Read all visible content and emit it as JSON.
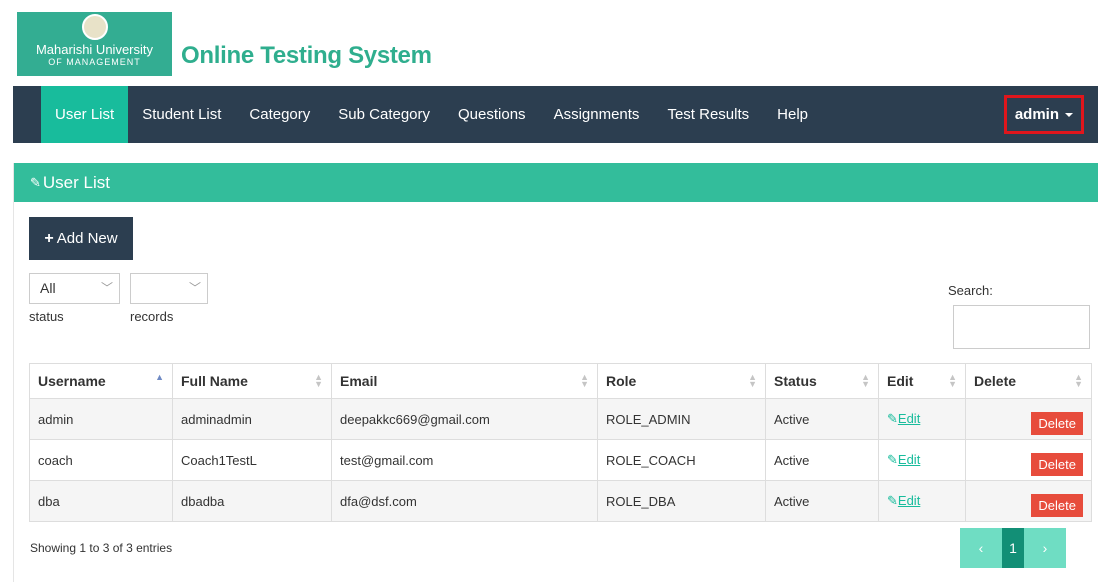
{
  "logo": {
    "line1": "Maharishi University",
    "line2": "OF MANAGEMENT"
  },
  "app_title": "Online Testing System",
  "nav": {
    "items": [
      "User List",
      "Student List",
      "Category",
      "Sub Category",
      "Questions",
      "Assignments",
      "Test Results",
      "Help"
    ],
    "active": "User List",
    "user_menu": "admin"
  },
  "panel": {
    "title": "User List",
    "add_button": "Add New",
    "status_filter": {
      "value": "All",
      "caption": "status"
    },
    "records_filter": {
      "value": "",
      "caption": "records"
    },
    "search_label": "Search:",
    "search_value": ""
  },
  "table": {
    "columns": [
      "Username",
      "Full Name",
      "Email",
      "Role",
      "Status",
      "Edit",
      "Delete"
    ],
    "rows": [
      {
        "username": "admin",
        "fullname": "adminadmin",
        "email": "deepakkc669@gmail.com",
        "role": "ROLE_ADMIN",
        "status": "Active",
        "edit": "Edit",
        "delete": "Delete"
      },
      {
        "username": "coach",
        "fullname": "Coach1TestL",
        "email": "test@gmail.com",
        "role": "ROLE_COACH",
        "status": "Active",
        "edit": "Edit",
        "delete": "Delete"
      },
      {
        "username": "dba",
        "fullname": "dbadba",
        "email": "dfa@dsf.com",
        "role": "ROLE_DBA",
        "status": "Active",
        "edit": "Edit",
        "delete": "Delete"
      }
    ]
  },
  "footer": {
    "info": "Showing 1 to 3 of 3 entries",
    "pager": {
      "prev": "‹",
      "current": "1",
      "next": "›"
    }
  },
  "colors": {
    "navbar": "#2c3e50",
    "accent": "#18bc9c",
    "panel_heading": "#33bd9b",
    "delete": "#e74c3c",
    "highlight_border": "#e0161c"
  }
}
